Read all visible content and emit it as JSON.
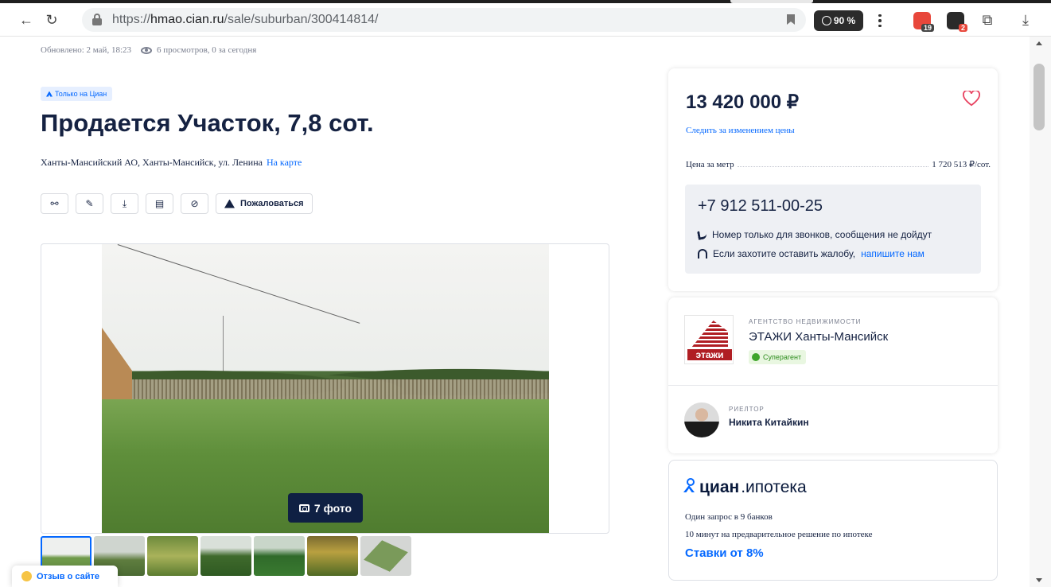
{
  "browser": {
    "url_prefix": "https://",
    "url_host": "hmao.cian.ru",
    "url_path": "/sale/suburban/300414814/",
    "zoom": "90 %",
    "ext_badges": [
      "19",
      "2"
    ]
  },
  "meta": {
    "updated": "Обновлено: 2 май, 18:23",
    "views": "6 просмотров, 0 за сегодня"
  },
  "badge": "Только на Циан",
  "title": "Продается Участок, 7,8 сот.",
  "address": {
    "text": "Ханты-Мансийский АО, Ханты-Мансийск, ул. Ленина",
    "map_link": "На карте"
  },
  "actions": {
    "complain_label": "Пожаловаться"
  },
  "gallery": {
    "photo_count": "7 фото",
    "thumb_count": 7
  },
  "feedback": "Отзыв о сайте",
  "price_card": {
    "price": "13 420 000 ₽",
    "follow": "Следить за изменением цены",
    "price_per_label": "Цена за метр",
    "price_per_value": "1 720 513 ₽/сот.",
    "phone": "+7 912 511-00-25",
    "note_calls": "Номер только для звонков, сообщения не дойдут",
    "note_complaint": "Если захотите оставить жалобу,",
    "note_link": "напишите нам"
  },
  "agency": {
    "label": "АГЕНТСТВО НЕДВИЖИМОСТИ",
    "name": "ЭТАЖИ Ханты-Мансийск",
    "logo_text": "этажи",
    "super": "Суперагент",
    "realtor_label": "РИЕЛТОР",
    "realtor_name": "Никита Китайкин"
  },
  "mortgage": {
    "brand": "циан",
    "sub": ".ипотека",
    "line1": "Один запрос в 9 банков",
    "line2": "10 минут на предварительное решение по ипотеке",
    "rates": "Ставки от 8%"
  },
  "colors": {
    "accent": "#0468ff",
    "text": "#152242",
    "brand_red": "#b01e23"
  }
}
